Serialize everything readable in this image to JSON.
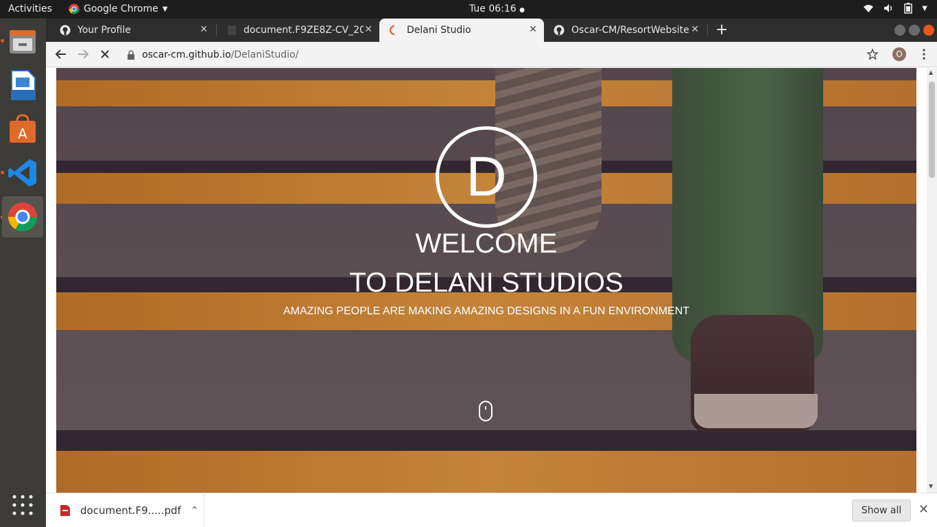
{
  "topbar": {
    "activities": "Activities",
    "app_name": "Google Chrome",
    "clock": "Tue 06:16"
  },
  "dock": {
    "items": [
      {
        "name": "files-icon"
      },
      {
        "name": "libreoffice-writer-icon"
      },
      {
        "name": "software-center-icon"
      },
      {
        "name": "vscode-icon"
      },
      {
        "name": "chrome-icon"
      }
    ]
  },
  "tabs": [
    {
      "title": "Your Profile",
      "icon": "github-icon"
    },
    {
      "title": "document.F9ZE8Z-CV_20",
      "icon": "document-icon"
    },
    {
      "title": "Delani Studio",
      "icon": "loading-icon",
      "active": true
    },
    {
      "title": "Oscar-CM/ResortWebsite",
      "icon": "github-icon"
    }
  ],
  "address": {
    "host": "oscar-cm.github.io",
    "path": "/DelaniStudio/"
  },
  "profile_initial": "O",
  "hero": {
    "logo_letter": "D",
    "line1": "WELCOME",
    "line2": "TO DELANI STUDIOS",
    "tagline": "AMAZING PEOPLE ARE MAKING AMAZING DESIGNS IN A FUN ENVIRONMENT"
  },
  "downloads": {
    "file_name": "document.F9.....pdf",
    "show_all": "Show all"
  },
  "colors": {
    "accent": "#e95420",
    "topbar": "#1d1d1d",
    "dock": "#3c3b37"
  }
}
